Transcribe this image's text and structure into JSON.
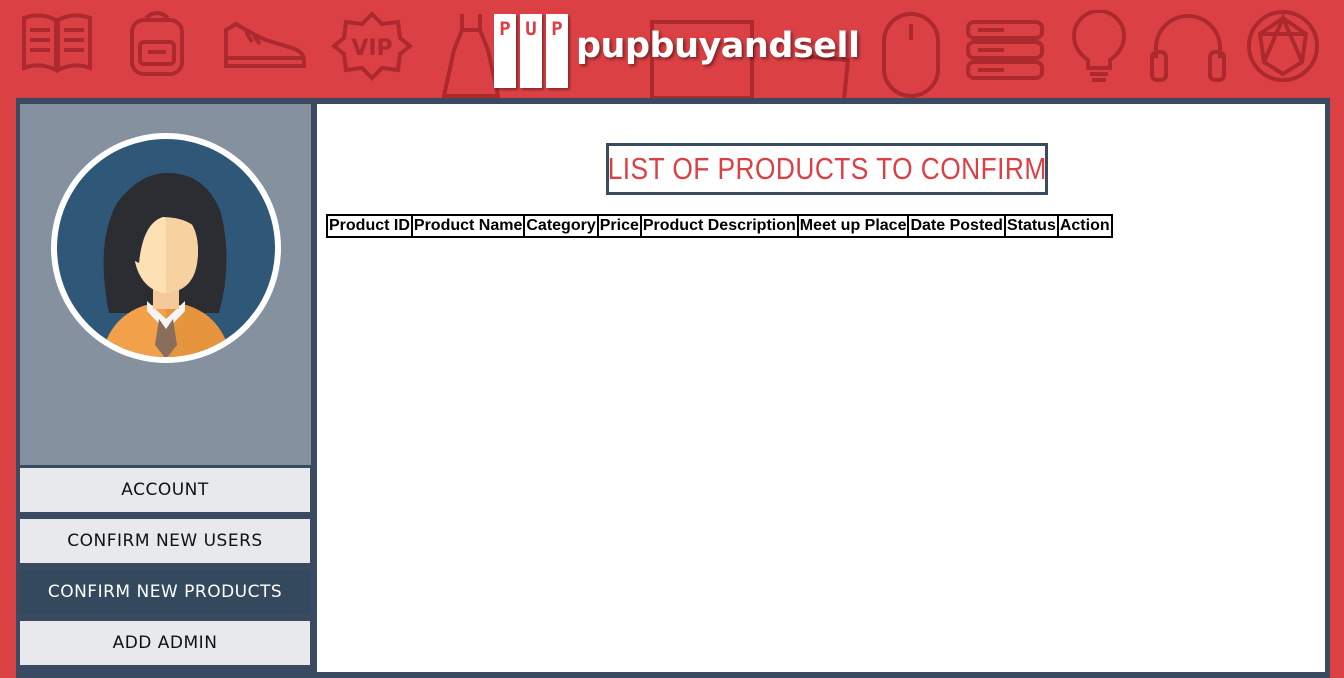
{
  "brand": {
    "logo_letters": [
      "P",
      "U",
      "P"
    ],
    "logo_text": "pupbuyandsell"
  },
  "header_decor_icons": [
    "book-icon",
    "backpack-icon",
    "sneaker-icon",
    "vip-badge-icon",
    "dress-icon",
    "mouse-icon",
    "server-icon",
    "lightbulb-icon",
    "headphones-icon",
    "gem-icon"
  ],
  "sidebar": {
    "menu": [
      {
        "label": "ACCOUNT",
        "active": false
      },
      {
        "label": "CONFIRM NEW USERS",
        "active": false
      },
      {
        "label": "CONFIRM NEW PRODUCTS",
        "active": true
      },
      {
        "label": "ADD ADMIN",
        "active": false
      }
    ]
  },
  "main": {
    "title": "LIST OF PRODUCTS TO CONFIRM",
    "table": {
      "columns": [
        "Product ID",
        "Product Name",
        "Category",
        "Price",
        "Product Description",
        "Meet up Place",
        "Date Posted",
        "Status",
        "Action"
      ],
      "rows": []
    }
  },
  "colors": {
    "brand_red": "#db4044",
    "frame_navy": "#3a4a60",
    "active_menu": "#34495e",
    "avatar_panel": "#8691a0"
  }
}
